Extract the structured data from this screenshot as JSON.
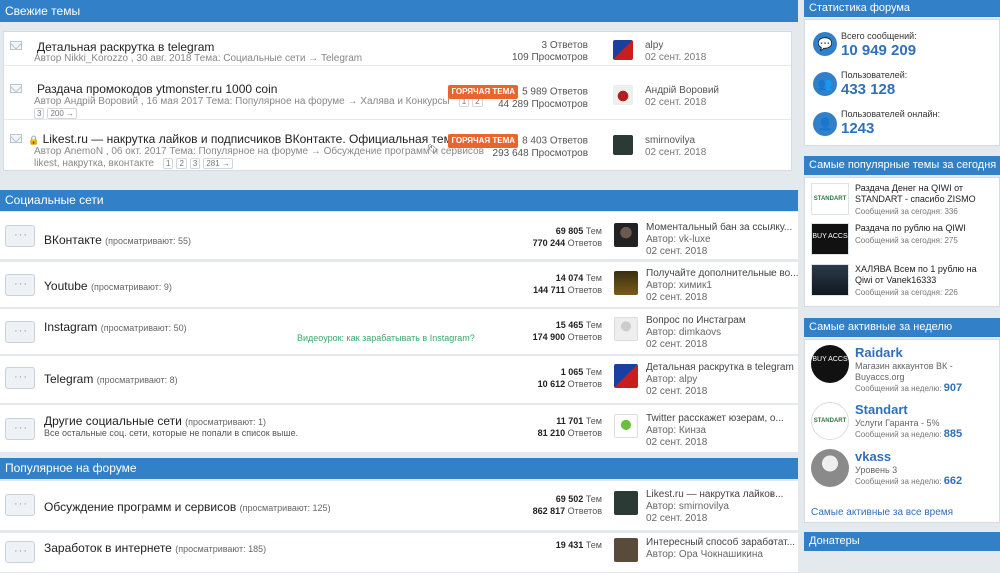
{
  "latest": {
    "header": "Свежие темы",
    "rows": [
      {
        "title": "Детальная раскрутка в telegram",
        "meta": "Автор Nikki_Korozzo , 30 авг. 2018 Тема: Социальные сети → Telegram",
        "replies": "3 Ответов",
        "views": "109 Просмотров",
        "user": "alpy",
        "date": "02 сент. 2018"
      },
      {
        "title": "Раздача промокодов ytmonster.ru 1000 coin",
        "meta": "Автор Андрій Воровий , 16 мая 2017 Тема: Популярное на форуме → Халява и Конкурсы",
        "pages": [
          "1",
          "2",
          "3",
          "200 →"
        ],
        "hot": "ГОРЯЧАЯ ТЕМА",
        "replies": "5 989 Ответов",
        "views": "44 289 Просмотров",
        "user": "Андрій Воровий",
        "date": "02 сент. 2018"
      },
      {
        "title": "Likest.ru — накрутка лайков и подписчиков ВКонтакте. Официальная тема.",
        "meta": "Автор AnemoN , 06 окт. 2017 Тема: Популярное на форуме → Обсуждение программ и сервисов",
        "meta2": "likest, накрутка, вконтакте",
        "pages": [
          "1",
          "2",
          "3",
          "281 →"
        ],
        "hot": "ГОРЯЧАЯ ТЕМА",
        "replies": "8 403 Ответов",
        "views": "293 648 Просмотров",
        "user": "smirnovilya",
        "date": "02 сент. 2018"
      }
    ]
  },
  "social": {
    "header": "Социальные сети",
    "rows": [
      {
        "name": "ВКонтакте",
        "viewing": "(просматривают: 55)",
        "topics": "69 805",
        "posts": "770 244",
        "last_title": "Моментальный бан за ссылку...",
        "last_author": "Автор: vk-luxe",
        "last_date": "02 сент. 2018"
      },
      {
        "name": "Youtube",
        "viewing": "(просматривают: 9)",
        "topics": "14 074",
        "posts": "144 711",
        "last_title": "Получайте дополнительные во...",
        "last_author": "Автор: химик1",
        "last_date": "02 сент. 2018"
      },
      {
        "name": "Instagram",
        "viewing": "(просматривают: 50)",
        "extra": "Видеоурок: как зарабатывать в Instagram?",
        "topics": "15 465",
        "posts": "174 900",
        "last_title": "Вопрос по Инстаграм",
        "last_author": "Автор: dimkaovs",
        "last_date": "02 сент. 2018"
      },
      {
        "name": "Telegram",
        "viewing": "(просматривают: 8)",
        "topics": "1 065",
        "posts": "10 612",
        "last_title": "Детальная раскрутка в telegram",
        "last_author": "Автор: alpy",
        "last_date": "02 сент. 2018"
      },
      {
        "name": "Другие социальные сети",
        "viewing": "(просматривают: 1)",
        "desc": "Все остальные соц. сети, которые не попали в список выше.",
        "topics": "11 701",
        "posts": "81 210",
        "last_title": "Twitter расскажет юзерам, о...",
        "last_author": "Автор: Кинза",
        "last_date": "02 сент. 2018"
      }
    ],
    "tem": "Тем",
    "otv": "Ответов"
  },
  "popular": {
    "header": "Популярное на форуме",
    "rows": [
      {
        "name": "Обсуждение программ и сервисов",
        "viewing": "(просматривают: 125)",
        "topics": "69 502",
        "posts": "862 817",
        "last_title": "Likest.ru — накрутка лайков...",
        "last_author": "Автор: smirnovilya",
        "last_date": "02 сент. 2018"
      },
      {
        "name": "Заработок в интернете",
        "viewing": "(просматривают: 185)",
        "topics": "19 431",
        "posts": "",
        "last_title": "Интересный способ заработат...",
        "last_author": "Автор: Ора Чокнашикина",
        "last_date": ""
      }
    ]
  },
  "stats": {
    "header": "Статистика форума",
    "items": [
      {
        "label": "Всего сообщений:",
        "value": "10 949 209",
        "icon": "chat-icon"
      },
      {
        "label": "Пользователей:",
        "value": "433 128",
        "icon": "users-icon"
      },
      {
        "label": "Пользователей онлайн:",
        "value": "1243",
        "icon": "user-icon"
      }
    ]
  },
  "pop_today": {
    "header": "Самые популярные темы за сегодня",
    "items": [
      {
        "title1": "Раздача Денег на QIWI от",
        "title2": "STANDART - спасибо ZISMO",
        "sub": "Сообщений за сегодня: 336",
        "img": "STANDART"
      },
      {
        "title1": "Раздача по рублю на QIWI",
        "title2": "",
        "sub": "Сообщений за сегодня: 275",
        "img": "BUY ACCS"
      },
      {
        "title1": "ХАЛЯВА Всем по 1 рублю на",
        "title2": "Qiwi от Vanek16333",
        "sub": "Сообщений за сегодня: 226",
        "img": ""
      }
    ]
  },
  "active_week": {
    "header": "Самые активные за неделю",
    "items": [
      {
        "name": "Raidark",
        "s1": "Магазин аккаунтов ВК -",
        "s2": "Buyaccs.org",
        "msgs_label": "Сообщений за неделю:",
        "msgs": "907",
        "img": "BUY ACCS"
      },
      {
        "name": "Standart",
        "s1": "Услуги Гаранта - 5%",
        "s2": "",
        "msgs_label": "Сообщений за неделю:",
        "msgs": "885",
        "img": "STANDART"
      },
      {
        "name": "vkass",
        "s1": "Уровень 3",
        "s2": "",
        "msgs_label": "Сообщений за неделю:",
        "msgs": "662",
        "img": ""
      }
    ],
    "all_time": "Самые активные за все время"
  },
  "donors": {
    "header": "Донатеры"
  },
  "colors": {
    "header": "#3180c8",
    "accent": "#3070b8",
    "hot": "#e8652d",
    "green": "#3aa76d"
  }
}
